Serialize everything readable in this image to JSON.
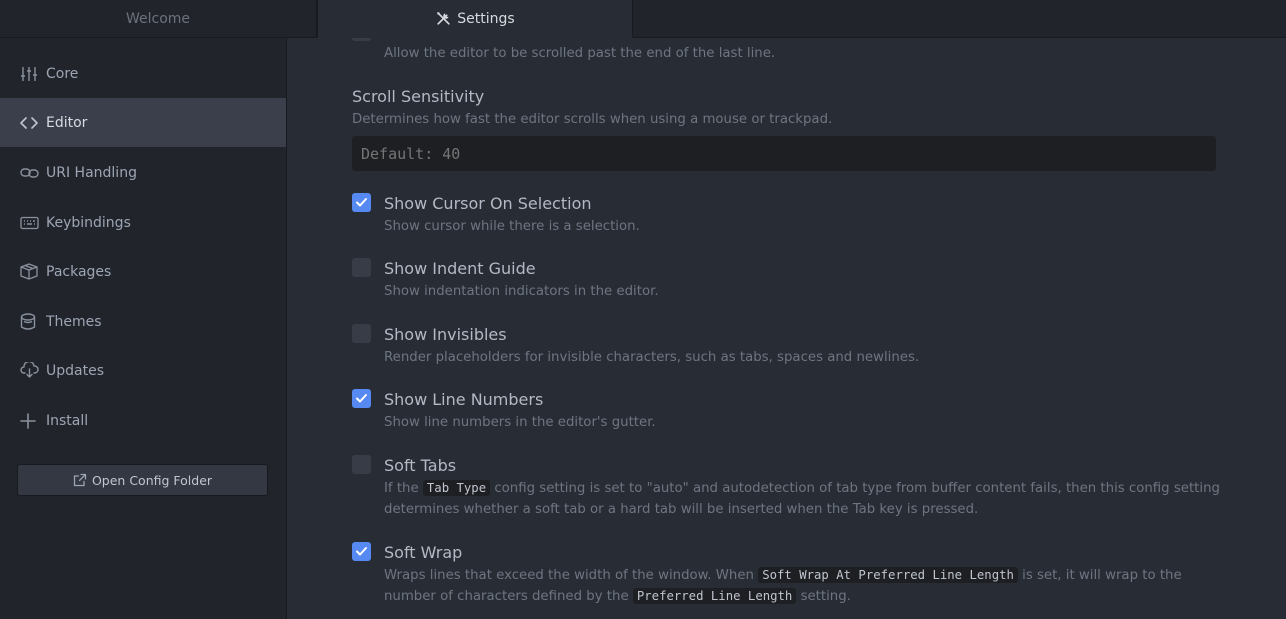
{
  "tabs": {
    "welcome": "Welcome",
    "settings": "Settings"
  },
  "sidebar": {
    "items": [
      {
        "label": "Core",
        "icon": "sliders-icon"
      },
      {
        "label": "Editor",
        "icon": "code-icon"
      },
      {
        "label": "URI Handling",
        "icon": "link-icon"
      },
      {
        "label": "Keybindings",
        "icon": "keyboard-icon"
      },
      {
        "label": "Packages",
        "icon": "package-icon"
      },
      {
        "label": "Themes",
        "icon": "paintcan-icon"
      },
      {
        "label": "Updates",
        "icon": "cloud-download-icon"
      },
      {
        "label": "Install",
        "icon": "plus-icon"
      }
    ],
    "open_config_label": "Open Config Folder"
  },
  "settings": {
    "scroll_past_end": {
      "description": "Allow the editor to be scrolled past the end of the last line."
    },
    "scroll_sensitivity": {
      "title": "Scroll Sensitivity",
      "description": "Determines how fast the editor scrolls when using a mouse or trackpad.",
      "placeholder": "Default: 40"
    },
    "show_cursor_on_selection": {
      "title": "Show Cursor On Selection",
      "description": "Show cursor while there is a selection.",
      "checked": true
    },
    "show_indent_guide": {
      "title": "Show Indent Guide",
      "description": "Show indentation indicators in the editor.",
      "checked": false
    },
    "show_invisibles": {
      "title": "Show Invisibles",
      "description": "Render placeholders for invisible characters, such as tabs, spaces and newlines.",
      "checked": false
    },
    "show_line_numbers": {
      "title": "Show Line Numbers",
      "description": "Show line numbers in the editor's gutter.",
      "checked": true
    },
    "soft_tabs": {
      "title": "Soft Tabs",
      "desc_part1": "If the",
      "desc_code": "Tab Type",
      "desc_part2": "config setting is set to \"auto\" and autodetection of tab type from buffer content fails, then this config setting",
      "desc_line2": "determines whether a soft tab or a hard tab will be inserted when the Tab key is pressed.",
      "checked": false
    },
    "soft_wrap": {
      "title": "Soft Wrap",
      "desc_part1": "Wraps lines that exceed the width of the window. When",
      "desc_code1": "Soft Wrap At Preferred Line Length",
      "desc_part2": "is set, it will wrap to the",
      "desc_line2_part1": "number of characters defined by the",
      "desc_code2": "Preferred Line Length",
      "desc_line2_part2": "setting.",
      "checked": true
    }
  }
}
